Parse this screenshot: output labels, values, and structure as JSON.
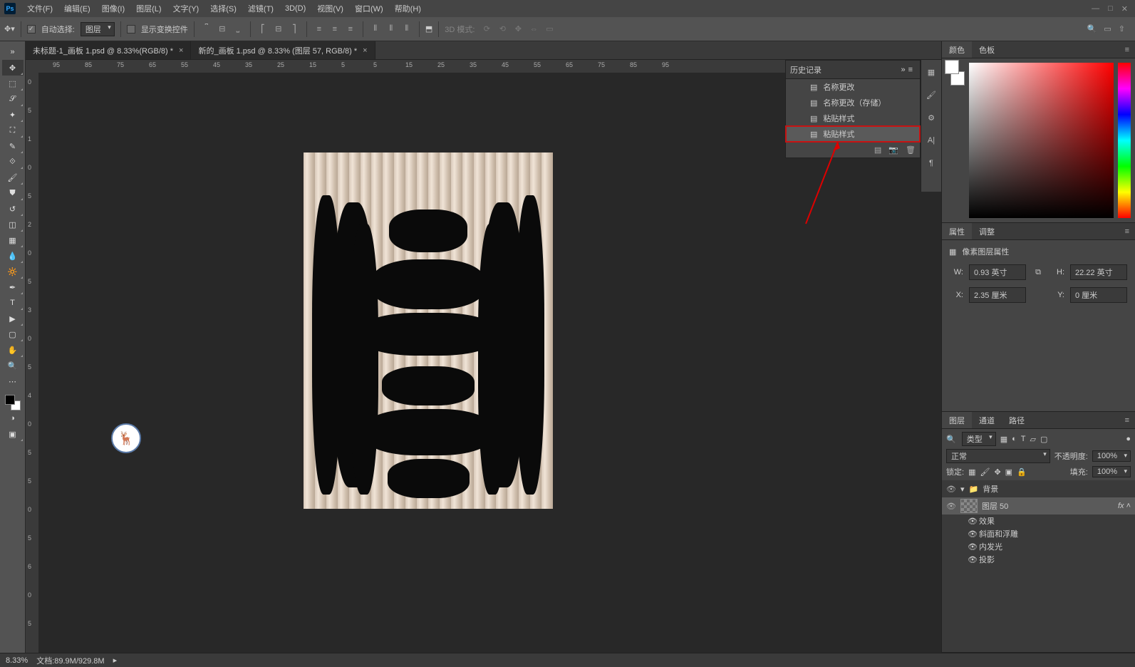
{
  "menu": {
    "file": "文件(F)",
    "edit": "编辑(E)",
    "image": "图像(I)",
    "layer": "图层(L)",
    "type": "文字(Y)",
    "select": "选择(S)",
    "filter": "滤镜(T)",
    "three_d": "3D(D)",
    "view": "视图(V)",
    "window": "窗口(W)",
    "help": "帮助(H)"
  },
  "optbar": {
    "auto_select": "自动选择:",
    "layer_dd": "图层",
    "show_transform": "显示变换控件",
    "mode_3d": "3D 模式:"
  },
  "tabs": {
    "t1": "未标题-1_画板 1.psd @ 8.33%(RGB/8) *",
    "t2": "新的_画板 1.psd @ 8.33% (图层 57, RGB/8) *"
  },
  "history": {
    "title": "历史记录",
    "e1": "名称更改",
    "e2": "名称更改（存储）",
    "e3": "粘贴样式",
    "e4": "粘贴样式"
  },
  "color": {
    "tab1": "颜色",
    "tab2": "色板"
  },
  "props": {
    "tab1": "属性",
    "tab2": "调整",
    "layer_kind": "像素图层属性",
    "w": "W:",
    "w_val": "0.93 英寸",
    "h": "H:",
    "h_val": "22.22 英寸",
    "x": "X:",
    "x_val": "2.35 厘米",
    "y": "Y:",
    "y_val": "0 厘米"
  },
  "layers": {
    "tab1": "图层",
    "tab2": "通道",
    "tab3": "路径",
    "kind": "类型",
    "blend": "正常",
    "opacity_lbl": "不透明度:",
    "opacity": "100%",
    "lock_lbl": "锁定:",
    "fill_lbl": "填充:",
    "fill": "100%",
    "group": "背景",
    "layer_name": "图层 50",
    "fx": "效果",
    "fx1": "斜面和浮雕",
    "fx2": "内发光",
    "fx3": "投影"
  },
  "status": {
    "zoom": "8.33%",
    "doc": "文档:89.9M/929.8M"
  },
  "rulers_h": [
    "95",
    "85",
    "75",
    "65",
    "55",
    "45",
    "35",
    "25",
    "15",
    "5",
    "5",
    "15",
    "25",
    "35",
    "45",
    "55",
    "65",
    "75",
    "85",
    "95"
  ],
  "rulers_v": [
    "0",
    "5",
    "1",
    "0",
    "5",
    "2",
    "0",
    "5",
    "3",
    "0",
    "5",
    "4",
    "0",
    "5",
    "5",
    "0",
    "5",
    "6",
    "0",
    "5"
  ]
}
